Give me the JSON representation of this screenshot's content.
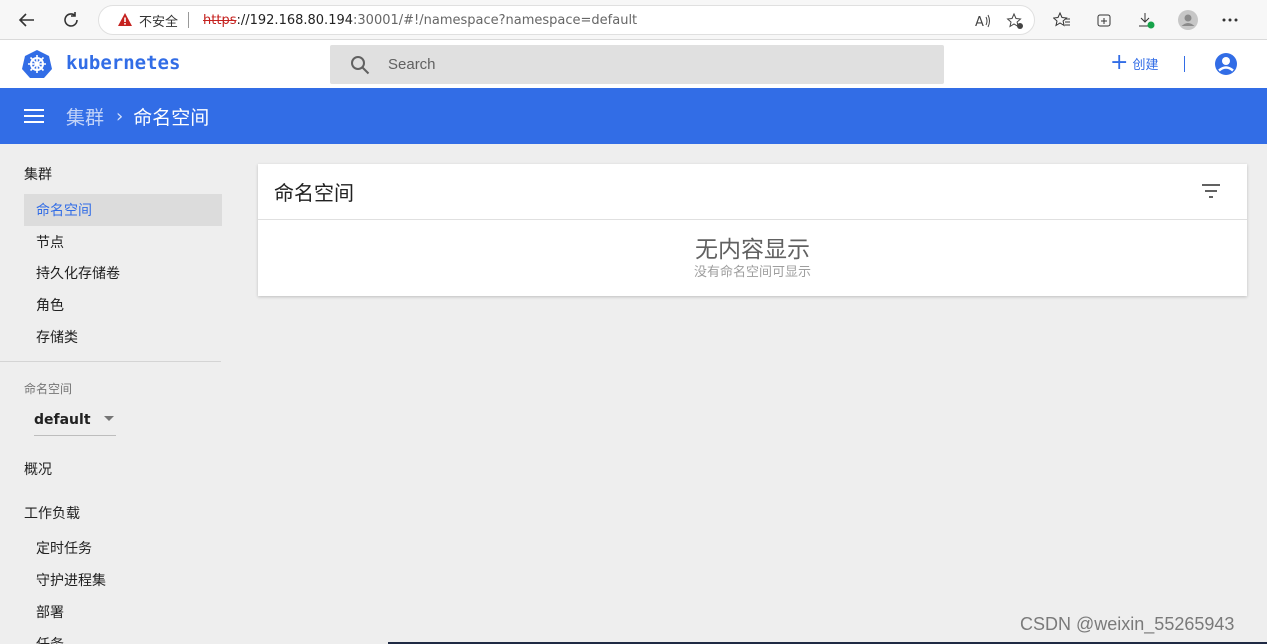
{
  "browser": {
    "insecure_label": "不安全",
    "url_scheme": "https",
    "url_host": "://192.168.80.194",
    "url_path": ":30001/#!/namespace?namespace=default"
  },
  "header": {
    "brand": "kubernetes",
    "search_placeholder": "Search",
    "create_label": "创建"
  },
  "toolbar": {
    "breadcrumb_parent": "集群",
    "breadcrumb_separator": "›",
    "breadcrumb_current": "命名空间"
  },
  "sidebar": {
    "cluster_heading": "集群",
    "cluster_items": [
      {
        "label": "命名空间",
        "active": true
      },
      {
        "label": "节点"
      },
      {
        "label": "持久化存储卷"
      },
      {
        "label": "角色"
      },
      {
        "label": "存储类"
      }
    ],
    "namespace_label": "命名空间",
    "namespace_value": "default",
    "overview": "概况",
    "workloads_heading": "工作负载",
    "workload_items": [
      {
        "label": "定时任务"
      },
      {
        "label": "守护进程集"
      },
      {
        "label": "部署"
      },
      {
        "label": "任务"
      }
    ]
  },
  "main": {
    "card_title": "命名空间",
    "empty_title": "无内容显示",
    "empty_subtitle": "没有命名空间可显示"
  },
  "watermark": "CSDN @weixin_55265943",
  "colors": {
    "accent": "#326de6",
    "background": "#eeeeee",
    "insecure_warning": "#c5221f"
  }
}
